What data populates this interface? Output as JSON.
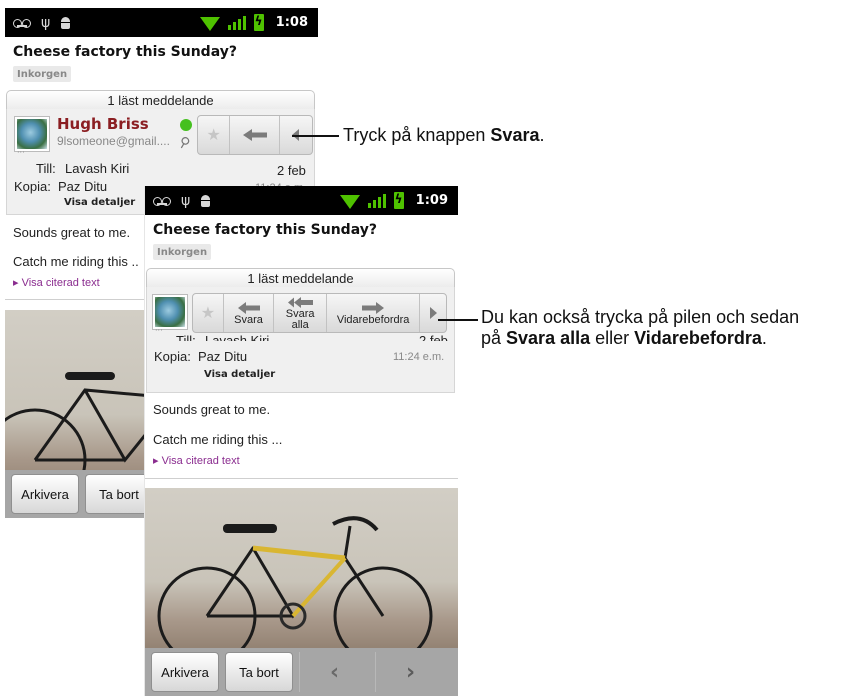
{
  "status_bar_1": {
    "time": "1:08"
  },
  "status_bar_2": {
    "time": "1:09"
  },
  "message": {
    "subject": "Cheese factory this Sunday?",
    "label": "Inkorgen",
    "count_text": "1 läst meddelande",
    "sender_name": "Hugh Briss",
    "sender_email": "9lsomeone@gmail....",
    "to_label": "Till:",
    "to_value": "Lavash Kiri",
    "cc_label": "Kopia:",
    "cc_value": "Paz Ditu",
    "date": "2 feb",
    "time": "11:24 e.m.",
    "details_link": "Visa detaljer",
    "body_line_1": "Sounds great to me.",
    "body_line_2_screen1": "Catch me riding this ..",
    "body_line_2_screen2": "Catch me riding this ...",
    "quoted_link": "▸ Visa citerad text"
  },
  "buttons": {
    "reply": "Svara",
    "reply_all": "Svara alla",
    "forward": "Vidarebefordra"
  },
  "action_bar": {
    "archive": "Arkivera",
    "delete": "Ta bort",
    "prev_icon": "chevron-left-icon",
    "next_icon": "chevron-right-icon"
  },
  "callouts": {
    "c1_pre": "Tryck på knappen ",
    "c1_bold": "Svara",
    "c1_post": ".",
    "c2_line1": "Du kan också trycka på pilen och sedan",
    "c2_pre": "på ",
    "c2_bold1": "Svara alla",
    "c2_mid": " eller ",
    "c2_bold2": "Vidarebefordra",
    "c2_post": "."
  },
  "colors": {
    "sender": "#8b1e22",
    "presence": "#45c01f",
    "link": "#8a2c8f",
    "status_icons": "#4fc200"
  }
}
